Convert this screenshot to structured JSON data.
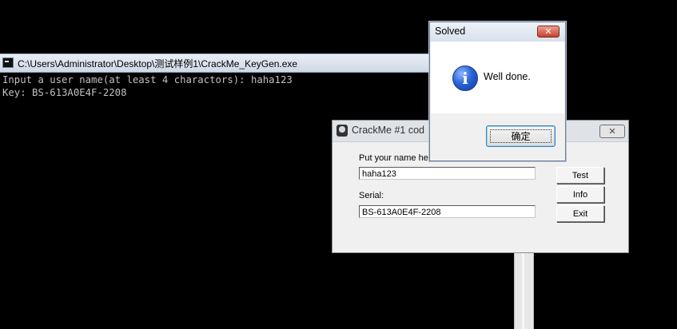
{
  "console": {
    "title": "C:\\Users\\Administrator\\Desktop\\测试样例1\\CrackMe_KeyGen.exe",
    "lines": [
      "Input a user name(at least 4 charactors): haha123",
      "Key: BS-613A0E4F-2208"
    ]
  },
  "crackme": {
    "title": "CrackMe #1 cod",
    "close_glyph": "✕",
    "name_label": "Put your name here:",
    "name_value": "haha123",
    "serial_label": "Serial:",
    "serial_value": "BS-613A0E4F-2208",
    "buttons": {
      "test": "Test",
      "info": "Info",
      "exit": "Exit"
    }
  },
  "dialog": {
    "title": "Solved",
    "close_glyph": "✕",
    "icon_glyph": "i",
    "message": "Well done.",
    "ok_label": "确定"
  }
}
